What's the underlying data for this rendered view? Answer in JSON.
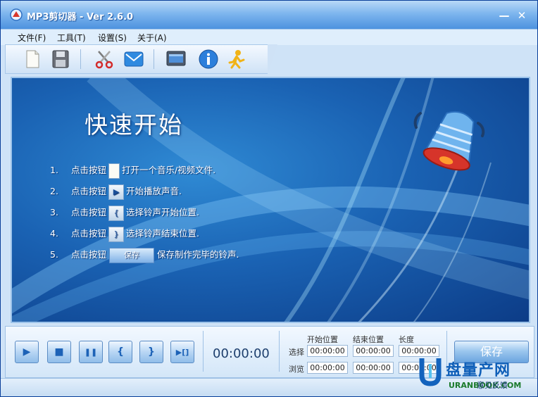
{
  "window": {
    "title": "MP3剪切器 - Ver 2.6.0",
    "minimize_glyph": "—",
    "close_glyph": "✕"
  },
  "menu": {
    "items": [
      {
        "label": "文件(F)"
      },
      {
        "label": "工具(T)"
      },
      {
        "label": "设置(S)"
      },
      {
        "label": "关于(A)"
      }
    ]
  },
  "toolbar": {
    "buttons": [
      {
        "icon": "new-file-icon"
      },
      {
        "icon": "save-disk-icon"
      },
      {
        "icon": "scissors-icon"
      },
      {
        "icon": "mail-icon"
      },
      {
        "icon": "monitor-icon"
      },
      {
        "icon": "info-icon"
      },
      {
        "icon": "running-person-icon"
      }
    ]
  },
  "banner": {
    "title": "快速开始",
    "steps": [
      {
        "num": "1.",
        "prefix": "点击按钮",
        "button": "",
        "suffix": "打开一个音乐/视频文件."
      },
      {
        "num": "2.",
        "prefix": "点击按钮",
        "button": "▶",
        "suffix": "开始播放声音."
      },
      {
        "num": "3.",
        "prefix": "点击按钮",
        "button": "{",
        "suffix": "选择铃声开始位置."
      },
      {
        "num": "4.",
        "prefix": "点击按钮",
        "button": "}",
        "suffix": "选择铃声结束位置."
      },
      {
        "num": "5.",
        "prefix": "点击按钮",
        "button": "保存",
        "suffix": "保存制作完毕的铃声."
      }
    ]
  },
  "controls": {
    "buttons": [
      {
        "glyph": "▶",
        "icon": "play-icon"
      },
      {
        "glyph": "■",
        "icon": "stop-icon"
      },
      {
        "glyph": "❚❚",
        "icon": "pause-icon"
      },
      {
        "glyph": "{",
        "icon": "start-mark-icon"
      },
      {
        "glyph": "}",
        "icon": "end-mark-icon"
      },
      {
        "glyph": "▶[]",
        "icon": "play-selection-icon"
      }
    ],
    "timer": "00:00:00",
    "headers": {
      "start": "开始位置",
      "end": "结束位置",
      "length": "长度"
    },
    "rows": [
      {
        "label": "选择",
        "start": "00:00:00",
        "end": "00:00:00",
        "length": "00:00:00"
      },
      {
        "label": "浏览",
        "start": "00:00:00",
        "end": "00:00:00",
        "length": "00:00:00"
      }
    ],
    "save_label": "保存"
  },
  "watermark": {
    "brand": "盘量产网",
    "url": "URANBOOK.COM",
    "overlay": "意见反馈"
  },
  "colors": {
    "title_bar": "#4d92df",
    "banner_blue": "#1a62b3",
    "accent": "#0f5fb8"
  }
}
